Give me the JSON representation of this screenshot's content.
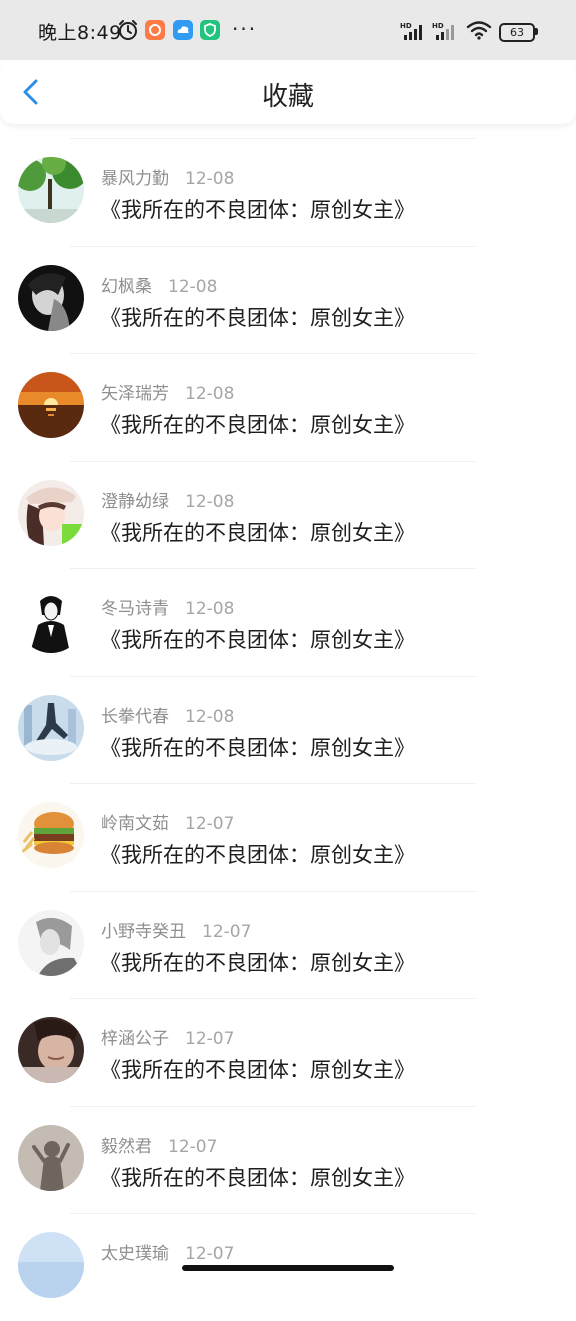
{
  "status_bar": {
    "time": "晚上8:49",
    "icons": [
      "alarm-icon",
      "app-notification-icon",
      "cloud-app-icon",
      "security-app-icon",
      "more-dots",
      "hd-signal-icon",
      "hd-signal-icon",
      "wifi-icon",
      "battery-icon"
    ],
    "more": "···",
    "battery_level": "63",
    "colors": {
      "bar_bg": "#e9e9e9",
      "app1": "#ff7a45",
      "app2": "#2f9bf3",
      "app3": "#21c47e"
    }
  },
  "header": {
    "title": "收藏",
    "back_icon": "chevron-left-icon",
    "accent_color": "#2b8ee8"
  },
  "favorites": [
    {
      "name": "暴风力勤",
      "date": "12-08",
      "title": "《我所在的不良团体：原创女主》",
      "avatar": "trees-avatar"
    },
    {
      "name": "幻枫桑",
      "date": "12-08",
      "title": "《我所在的不良团体：原创女主》",
      "avatar": "bw-portrait-avatar"
    },
    {
      "name": "矢泽瑞芳",
      "date": "12-08",
      "title": "《我所在的不良团体：原创女主》",
      "avatar": "sunset-avatar"
    },
    {
      "name": "澄静幼绿",
      "date": "12-08",
      "title": "《我所在的不良团体：原创女主》",
      "avatar": "anime-girl-avatar"
    },
    {
      "name": "冬马诗青",
      "date": "12-08",
      "title": "《我所在的不良团体：原创女主》",
      "avatar": "anime-boy-avatar"
    },
    {
      "name": "长拳代春",
      "date": "12-08",
      "title": "《我所在的不良团体：原创女主》",
      "avatar": "dancer-avatar"
    },
    {
      "name": "岭南文茹",
      "date": "12-07",
      "title": "《我所在的不良团体：原创女主》",
      "avatar": "burger-avatar"
    },
    {
      "name": "小野寺癸丑",
      "date": "12-07",
      "title": "《我所在的不良团体：原创女主》",
      "avatar": "sketch-avatar"
    },
    {
      "name": "梓涵公子",
      "date": "12-07",
      "title": "《我所在的不良团体：原创女主》",
      "avatar": "girl-photo-avatar"
    },
    {
      "name": "毅然君",
      "date": "12-07",
      "title": "《我所在的不良团体：原创女主》",
      "avatar": "shadow-avatar"
    },
    {
      "name": "太史璞瑜",
      "date": "12-07",
      "title": "",
      "avatar": "sky-avatar"
    }
  ]
}
